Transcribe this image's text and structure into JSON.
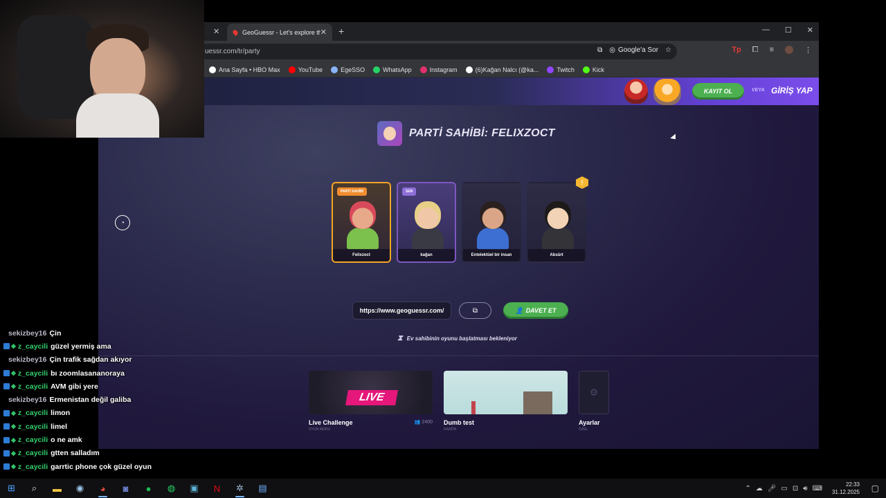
{
  "browser": {
    "active_tab_title": "GeoGuessr - Let's explore the w",
    "url": "uessr.com/tr/party",
    "google_sor": "Google'a Sor",
    "bookmarks": [
      {
        "label": "Ana Sayfa • HBO Max",
        "color": "#ffffff"
      },
      {
        "label": "YouTube",
        "color": "#ff0000"
      },
      {
        "label": "EgeSSO",
        "color": "#8ab4f8"
      },
      {
        "label": "WhatsApp",
        "color": "#25d366"
      },
      {
        "label": "Instagram",
        "color": "#e1306c"
      },
      {
        "label": "(6)Kağan Nalcı (@ka...",
        "color": "#ffffff"
      },
      {
        "label": "Twitch",
        "color": "#9146ff"
      },
      {
        "label": "Kick",
        "color": "#53fc18"
      }
    ]
  },
  "banner": {
    "kayit_ol": "KAYIT OL",
    "veya": "VEYA",
    "giris_yap": "GİRİŞ YAP"
  },
  "party": {
    "title": "PARTİ SAHİBİ: FELIXZOCT",
    "players": [
      {
        "name": "Felixzoct",
        "tag": "PARTİ SAHİBİ",
        "kind": "host"
      },
      {
        "name": "kağan",
        "tag": "SEN",
        "kind": "me"
      },
      {
        "name": "Entelektüel bir insan",
        "tag": "",
        "kind": "other"
      },
      {
        "name": "Absürt",
        "tag": "",
        "kind": "other"
      }
    ],
    "badge": "!",
    "invite_url": "https://www.geoguessr.com/",
    "davet_et": "DAVET ET",
    "waiting": "Ev sahibinin oyunu başlatması bekleniyor"
  },
  "modes": [
    {
      "title": "Live Challenge",
      "sub": "OYUN MODU",
      "count": "2400",
      "thumb_text": "LIVE"
    },
    {
      "title": "Dumb test",
      "sub": "HARİTA",
      "count": ""
    },
    {
      "title": "Ayarlar",
      "sub": "ÖZEL",
      "count": ""
    }
  ],
  "chat": [
    {
      "user": "sekizbey16",
      "msg": "Çin",
      "type": "grey"
    },
    {
      "user": "z_caycili",
      "msg": "güzel yermiş ama",
      "type": "green"
    },
    {
      "user": "sekizbey16",
      "msg": "Çin trafik sağdan akıyor",
      "type": "grey"
    },
    {
      "user": "z_caycili",
      "msg": "bı zoomlasananoraya",
      "type": "green"
    },
    {
      "user": "z_caycili",
      "msg": "AVM gibi yere",
      "type": "green"
    },
    {
      "user": "sekizbey16",
      "msg": "Ermenistan değil galiba",
      "type": "grey"
    },
    {
      "user": "z_caycili",
      "msg": "limon",
      "type": "green"
    },
    {
      "user": "z_caycili",
      "msg": "limel",
      "type": "green"
    },
    {
      "user": "z_caycili",
      "msg": "o ne amk",
      "type": "green"
    },
    {
      "user": "z_caycili",
      "msg": "gtten salladım",
      "type": "green"
    },
    {
      "user": "z_caycili",
      "msg": "garrtic phone çok güzel oyun",
      "type": "green"
    }
  ],
  "taskbar": {
    "time": "22:33",
    "date": "31.12.2025",
    "apps": [
      "windows-start",
      "search",
      "file-explorer",
      "steam",
      "chrome",
      "discord",
      "spotify",
      "whatsapp",
      "photos",
      "netflix",
      "settings-app",
      "notepad"
    ]
  }
}
